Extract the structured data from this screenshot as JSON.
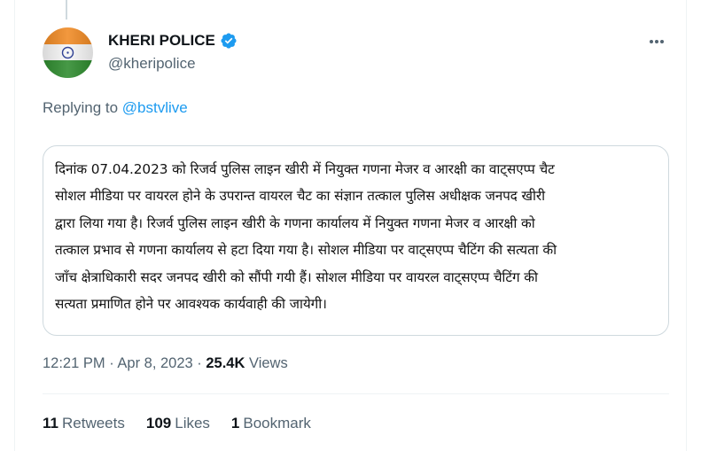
{
  "author": {
    "display_name": "KHERI POLICE",
    "handle": "@kheripolice",
    "verified": true,
    "avatar": "indian-flag-avatar"
  },
  "replying": {
    "prefix": "Replying to",
    "target": "@bstvlive"
  },
  "tweet": {
    "lines": [
      "दिनांक 07.04.2023 को रिजर्व पुलिस लाइन खीरी में नियुक्त गणना मेजर व आरक्षी का वाट्सएप्प चैट",
      "सोशल मीडिया पर वायरल होने के उपरान्त वायरल चैट का संज्ञान तत्काल पुलिस अधीक्षक जनपद खीरी",
      "द्वारा लिया गया है। रिजर्व पुलिस लाइन खीरी के गणना कार्यालय में नियुक्त गणना मेजर व आरक्षी को",
      "तत्काल प्रभाव से गणना कार्यालय से हटा दिया गया है। सोशल मीडिया पर वाट्सएप्प चैटिंग की सत्यता की",
      "जाँच क्षेत्राधिकारी सदर जनपद खीरी को सौंपी गयी हैं। सोशल मीडिया पर वायरल वाट्सएप्प चैटिंग की",
      "सत्यता प्रमाणित होने पर आवश्यक कार्यवाही की जायेगी।"
    ]
  },
  "meta": {
    "time": "12:21 PM",
    "separator": " · ",
    "date": "Apr 8, 2023",
    "views_count": "25.4K",
    "views_label": "Views"
  },
  "stats": {
    "retweets_count": "11",
    "retweets_label": "Retweets",
    "likes_count": "109",
    "likes_label": "Likes",
    "bookmarks_count": "1",
    "bookmarks_label": "Bookmark"
  },
  "colors": {
    "accent": "#1d9bf0",
    "secondary_text": "#536471",
    "border": "#cfd9de"
  }
}
